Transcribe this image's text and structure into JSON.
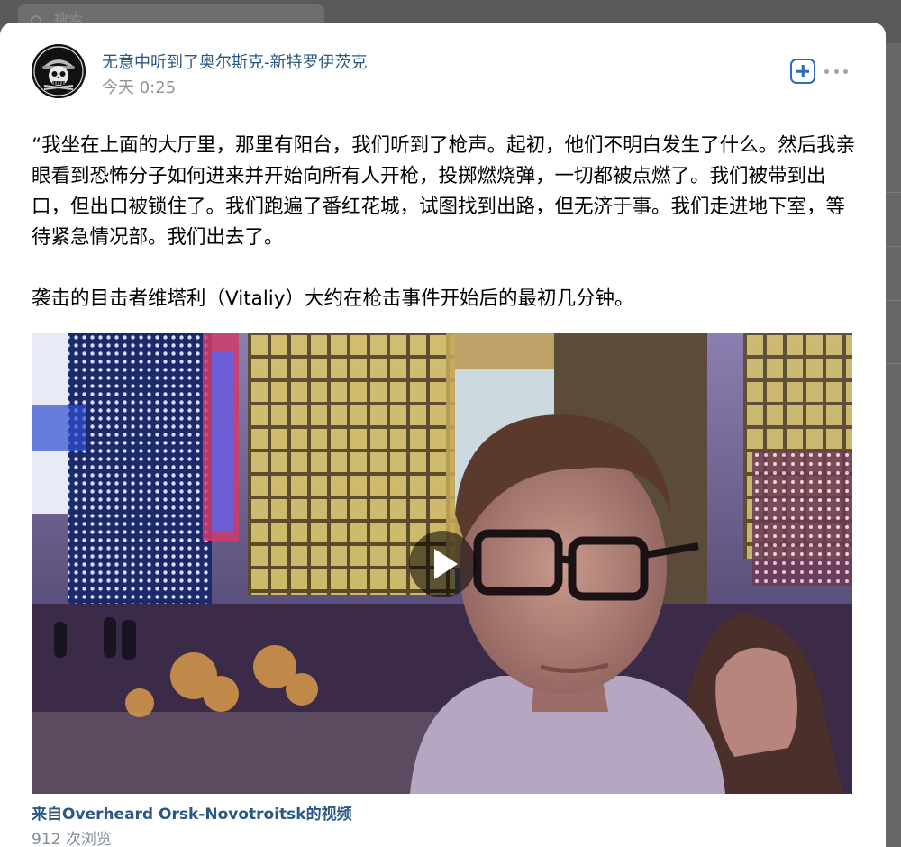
{
  "search": {
    "placeholder": "搜索"
  },
  "post": {
    "author": "无意中听到了奥尔斯克-新特罗伊茨克",
    "time": "今天 0:25",
    "paragraphs": [
      "“我坐在上面的大厅里，那里有阳台，我们听到了枪声。起初，他们不明白发生了什么。然后我亲眼看到恐怖分子如何进来并开始向所有人开枪，投掷燃烧弹，一切都被点燃了。我们被带到出口，但出口被锁住了。我们跑遍了番红花城，试图找到出路，但无济于事。我们走进地下室，等待紧急情况部。我们出去了。",
      "袭击的目击者维塔利（Vitaliy）大约在枪击事件开始后的最初几分钟。"
    ],
    "video": {
      "caption": "来自Overheard Orsk-Novotroitsk的视频",
      "views": "912 次浏览"
    }
  },
  "icons": {
    "add": "add-square-icon",
    "more": "more-horizontal-icon",
    "play": "play-icon",
    "search": "search-icon"
  },
  "colors": {
    "link": "#2a5885",
    "accent": "#2a6ebb",
    "muted": "#939393"
  }
}
